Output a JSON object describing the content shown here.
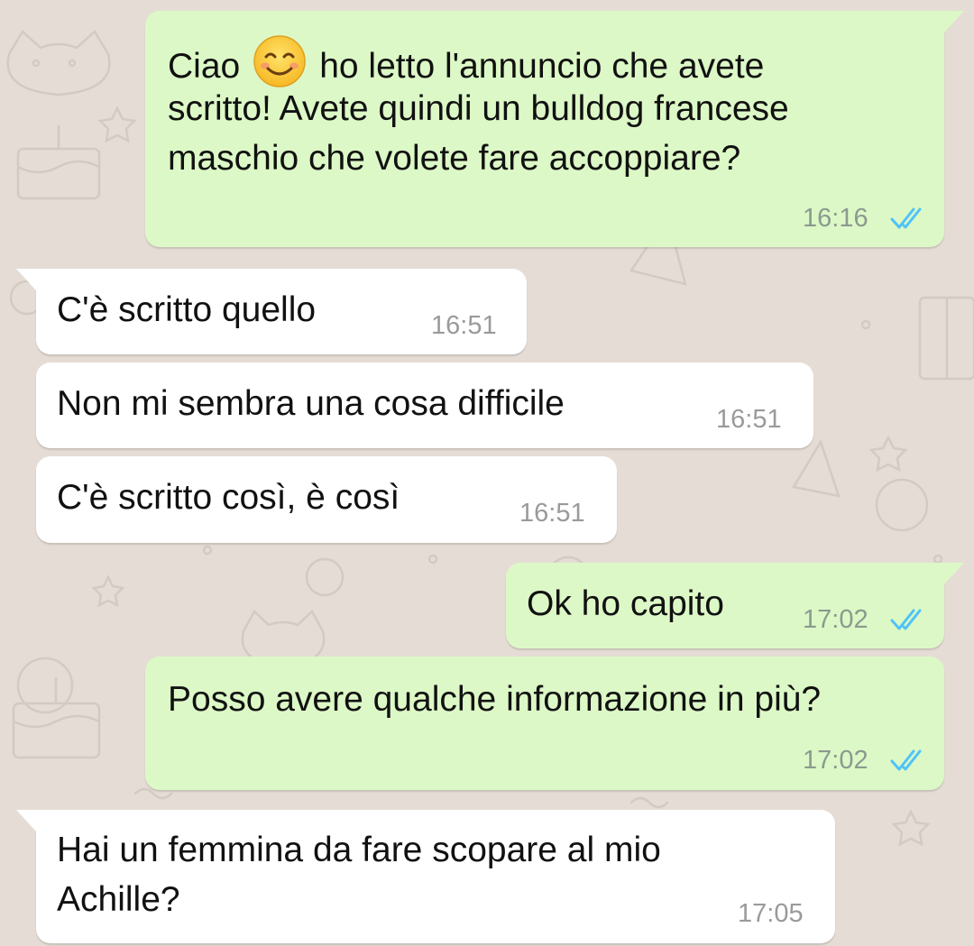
{
  "theme": {
    "outgoing_bubble": "#dcf8c6",
    "incoming_bubble": "#ffffff",
    "wallpaper": "#e5ddd5",
    "read_ticks": "#4fc3f7"
  },
  "messages": [
    {
      "direction": "outgoing",
      "lines": [
        "Ciao",
        "ho letto l'annuncio che avete",
        "scritto! Avete quindi un bulldog francese",
        "maschio che volete fare accoppiare?"
      ],
      "emoji": "smiling-face-emoji",
      "time": "16:16",
      "status": "read-double-check"
    },
    {
      "direction": "incoming",
      "text": "C'è scritto quello",
      "time": "16:51"
    },
    {
      "direction": "incoming",
      "text": "Non mi sembra una cosa difficile",
      "time": "16:51"
    },
    {
      "direction": "incoming",
      "text": "C'è scritto così, è così",
      "time": "16:51"
    },
    {
      "direction": "outgoing",
      "text": "Ok ho capito",
      "time": "17:02",
      "status": "read-double-check"
    },
    {
      "direction": "outgoing",
      "text": "Posso avere qualche informazione in più?",
      "time": "17:02",
      "status": "read-double-check"
    },
    {
      "direction": "incoming",
      "lines": [
        "Hai un femmina da fare scopare al mio",
        "Achille?"
      ],
      "time": "17:05"
    }
  ]
}
